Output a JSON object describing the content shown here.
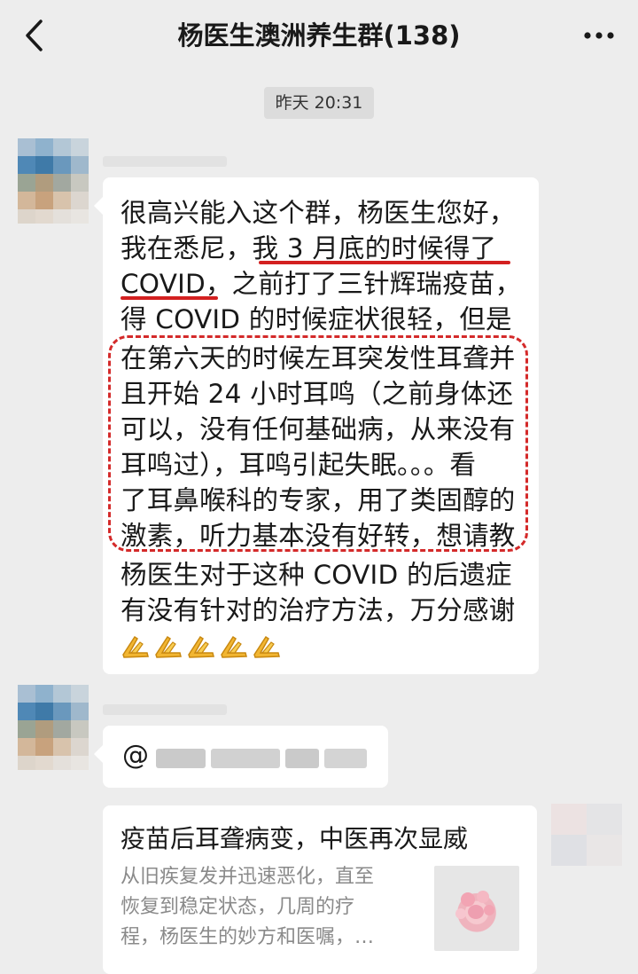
{
  "header": {
    "title": "杨医生澳洲养生群(138)",
    "back_icon": "chevron-left-icon",
    "more_icon": "more-dots-icon"
  },
  "timestamp": "昨天 20:31",
  "messages": [
    {
      "lines": [
        "很高兴能入这个群，杨医生您好，",
        "我在悉尼，我 3 月底的时候得了",
        "COVID，之前打了三针辉瑞疫苗，",
        "得 COVID 的时候症状很轻，但是",
        "在第六天的时候左耳突发性耳聋并",
        "且开始 24 小时耳鸣（之前身体还",
        "可以，没有任何基础病，从来没有",
        "耳鸣过），耳鸣引起失眠。。。看",
        "了耳鼻喉科的专家，用了类固醇的",
        "激素，听力基本没有好转，想请教",
        "杨医生对于这种 COVID 的后遗症",
        "有没有针对的治疗方法，万分感谢"
      ],
      "emoji": [
        "pray-icon",
        "pray-icon",
        "pray-icon",
        "pray-icon",
        "pray-icon"
      ],
      "annotation_color": "#d32020"
    },
    {
      "at_text": "@"
    }
  ],
  "link_card": {
    "title": "疫苗后耳聋病变，中医再次显威",
    "desc_lines": [
      "从旧疾复发并迅速恶化，直至",
      "恢复到稳定状态，几周的疗",
      "程，杨医生的妙方和医嘱，…"
    ],
    "thumbnail_icon": "flower-bouquet-image"
  },
  "colors": {
    "background": "#ededed",
    "bubble": "#ffffff",
    "annotation": "#d32020"
  }
}
